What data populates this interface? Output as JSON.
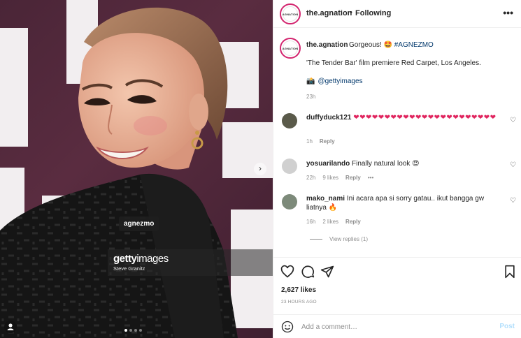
{
  "photo": {
    "tag_label": "agnezmo",
    "getty_logo_a": "getty",
    "getty_logo_b": "images",
    "getty_credit": "Steve Granitz",
    "next_icon": "chevron-right-icon",
    "carousel_count": 4,
    "carousel_active": 0
  },
  "header": {
    "username": "the.agnation",
    "separator": "•",
    "follow_status": "Following",
    "more_icon": "more-horizontal-icon"
  },
  "caption": {
    "username": "the.agnation",
    "text": "Gorgeous! 🤩",
    "hashtag": "#AGNEZMO",
    "line2": "'The Tender Bar' film premiere Red Carpet, Los Angeles.",
    "camera_emoji": "📸",
    "mention": "@gettyimages",
    "time": "23h"
  },
  "comments": [
    {
      "username": "duffyduck121",
      "text": "❤❤❤❤❤❤❤❤❤❤❤❤❤❤❤❤❤❤❤❤❤❤❤",
      "time": "1h",
      "likes": "",
      "reply": "Reply",
      "more": "",
      "avatar_color": "#5a5a4a"
    },
    {
      "username": "yosuarilando",
      "text": "Finally natural look 😍",
      "time": "22h",
      "likes": "9 likes",
      "reply": "Reply",
      "more": "•••",
      "avatar_color": "#c8c8c8"
    },
    {
      "username": "mako_nami",
      "text": "Ini acara apa si sorry gatau.. ikut bangga gw liatnya 🔥",
      "time": "16h",
      "likes": "2 likes",
      "reply": "Reply",
      "more": "",
      "avatar_color": "#7d8a7a"
    }
  ],
  "view_replies": "View replies (1)",
  "actions": {
    "likes": "2,627 likes",
    "posted": "23 HOURS AGO"
  },
  "add_comment": {
    "placeholder": "Add a comment…",
    "post_label": "Post"
  },
  "colors": {
    "brand_ring": "#d3256f",
    "link": "#00376b",
    "muted": "#8e8e8e",
    "post_disabled": "#b2dffc"
  }
}
